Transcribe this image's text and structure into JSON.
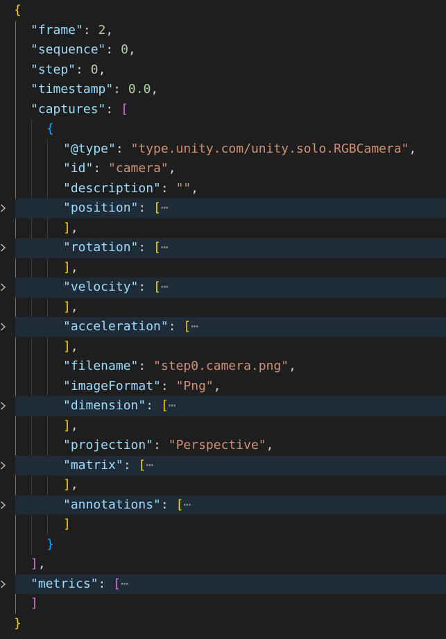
{
  "editor": {
    "language": "json",
    "colors": {
      "background": "#1e1e1e",
      "key": "#9cdcfe",
      "string": "#ce9178",
      "number": "#b5cea8",
      "bracket_level_1": "#ffd700",
      "bracket_level_2": "#da70d6",
      "bracket_level_3": "#179fff",
      "folded_highlight": "#1f2b36"
    },
    "lines": [
      {
        "tokens": [
          {
            "t": "{",
            "c": "b1"
          }
        ]
      },
      {
        "tokens": [
          {
            "t": "\"frame\"",
            "c": "k"
          },
          {
            "t": ": ",
            "c": "p"
          },
          {
            "t": "2",
            "c": "n"
          },
          {
            "t": ",",
            "c": "p"
          }
        ]
      },
      {
        "tokens": [
          {
            "t": "\"sequence\"",
            "c": "k"
          },
          {
            "t": ": ",
            "c": "p"
          },
          {
            "t": "0",
            "c": "n"
          },
          {
            "t": ",",
            "c": "p"
          }
        ]
      },
      {
        "tokens": [
          {
            "t": "\"step\"",
            "c": "k"
          },
          {
            "t": ": ",
            "c": "p"
          },
          {
            "t": "0",
            "c": "n"
          },
          {
            "t": ",",
            "c": "p"
          }
        ]
      },
      {
        "tokens": [
          {
            "t": "\"timestamp\"",
            "c": "k"
          },
          {
            "t": ": ",
            "c": "p"
          },
          {
            "t": "0.0",
            "c": "n"
          },
          {
            "t": ",",
            "c": "p"
          }
        ]
      },
      {
        "tokens": [
          {
            "t": "\"captures\"",
            "c": "k"
          },
          {
            "t": ": ",
            "c": "p"
          },
          {
            "t": "[",
            "c": "b2"
          }
        ]
      },
      {
        "tokens": [
          {
            "t": "{",
            "c": "b3"
          }
        ]
      },
      {
        "tokens": [
          {
            "t": "\"@type\"",
            "c": "k"
          },
          {
            "t": ": ",
            "c": "p"
          },
          {
            "t": "\"type.unity.com/unity.solo.RGBCamera\"",
            "c": "s"
          },
          {
            "t": ",",
            "c": "p"
          }
        ]
      },
      {
        "tokens": [
          {
            "t": "\"id\"",
            "c": "k"
          },
          {
            "t": ": ",
            "c": "p"
          },
          {
            "t": "\"camera\"",
            "c": "s"
          },
          {
            "t": ",",
            "c": "p"
          }
        ]
      },
      {
        "tokens": [
          {
            "t": "\"description\"",
            "c": "k"
          },
          {
            "t": ": ",
            "c": "p"
          },
          {
            "t": "\"\"",
            "c": "s"
          },
          {
            "t": ",",
            "c": "p"
          }
        ]
      },
      {
        "folded": true,
        "tokens": [
          {
            "t": "\"position\"",
            "c": "k"
          },
          {
            "t": ": ",
            "c": "p"
          },
          {
            "t": "[",
            "c": "b1"
          },
          {
            "t": "⋯",
            "c": "ell"
          }
        ]
      },
      {
        "tokens": [
          {
            "t": "]",
            "c": "b1"
          },
          {
            "t": ",",
            "c": "p"
          }
        ]
      },
      {
        "folded": true,
        "tokens": [
          {
            "t": "\"rotation\"",
            "c": "k"
          },
          {
            "t": ": ",
            "c": "p"
          },
          {
            "t": "[",
            "c": "b1"
          },
          {
            "t": "⋯",
            "c": "ell"
          }
        ]
      },
      {
        "tokens": [
          {
            "t": "]",
            "c": "b1"
          },
          {
            "t": ",",
            "c": "p"
          }
        ]
      },
      {
        "folded": true,
        "tokens": [
          {
            "t": "\"velocity\"",
            "c": "k"
          },
          {
            "t": ": ",
            "c": "p"
          },
          {
            "t": "[",
            "c": "b1"
          },
          {
            "t": "⋯",
            "c": "ell"
          }
        ]
      },
      {
        "tokens": [
          {
            "t": "]",
            "c": "b1"
          },
          {
            "t": ",",
            "c": "p"
          }
        ]
      },
      {
        "folded": true,
        "tokens": [
          {
            "t": "\"acceleration\"",
            "c": "k"
          },
          {
            "t": ": ",
            "c": "p"
          },
          {
            "t": "[",
            "c": "b1"
          },
          {
            "t": "⋯",
            "c": "ell"
          }
        ]
      },
      {
        "tokens": [
          {
            "t": "]",
            "c": "b1"
          },
          {
            "t": ",",
            "c": "p"
          }
        ]
      },
      {
        "tokens": [
          {
            "t": "\"filename\"",
            "c": "k"
          },
          {
            "t": ": ",
            "c": "p"
          },
          {
            "t": "\"step0.camera.png\"",
            "c": "s"
          },
          {
            "t": ",",
            "c": "p"
          }
        ]
      },
      {
        "tokens": [
          {
            "t": "\"imageFormat\"",
            "c": "k"
          },
          {
            "t": ": ",
            "c": "p"
          },
          {
            "t": "\"Png\"",
            "c": "s"
          },
          {
            "t": ",",
            "c": "p"
          }
        ]
      },
      {
        "folded": true,
        "tokens": [
          {
            "t": "\"dimension\"",
            "c": "k"
          },
          {
            "t": ": ",
            "c": "p"
          },
          {
            "t": "[",
            "c": "b1"
          },
          {
            "t": "⋯",
            "c": "ell"
          }
        ]
      },
      {
        "tokens": [
          {
            "t": "]",
            "c": "b1"
          },
          {
            "t": ",",
            "c": "p"
          }
        ]
      },
      {
        "tokens": [
          {
            "t": "\"projection\"",
            "c": "k"
          },
          {
            "t": ": ",
            "c": "p"
          },
          {
            "t": "\"Perspective\"",
            "c": "s"
          },
          {
            "t": ",",
            "c": "p"
          }
        ]
      },
      {
        "folded": true,
        "tokens": [
          {
            "t": "\"matrix\"",
            "c": "k"
          },
          {
            "t": ": ",
            "c": "p"
          },
          {
            "t": "[",
            "c": "b1"
          },
          {
            "t": "⋯",
            "c": "ell"
          }
        ]
      },
      {
        "tokens": [
          {
            "t": "]",
            "c": "b1"
          },
          {
            "t": ",",
            "c": "p"
          }
        ]
      },
      {
        "folded": true,
        "tokens": [
          {
            "t": "\"annotations\"",
            "c": "k"
          },
          {
            "t": ": ",
            "c": "p"
          },
          {
            "t": "[",
            "c": "b1"
          },
          {
            "t": "⋯",
            "c": "ell"
          }
        ]
      },
      {
        "tokens": [
          {
            "t": "]",
            "c": "b1"
          }
        ]
      },
      {
        "tokens": [
          {
            "t": "}",
            "c": "b3"
          }
        ]
      },
      {
        "tokens": [
          {
            "t": "]",
            "c": "b2"
          },
          {
            "t": ",",
            "c": "p"
          }
        ]
      },
      {
        "folded": true,
        "tokens": [
          {
            "t": "\"metrics\"",
            "c": "k"
          },
          {
            "t": ": ",
            "c": "p"
          },
          {
            "t": "[",
            "c": "b2"
          },
          {
            "t": "⋯",
            "c": "ell"
          }
        ]
      },
      {
        "tokens": [
          {
            "t": "]",
            "c": "b2"
          }
        ]
      },
      {
        "tokens": [
          {
            "t": "}",
            "c": "b1"
          }
        ]
      }
    ]
  }
}
